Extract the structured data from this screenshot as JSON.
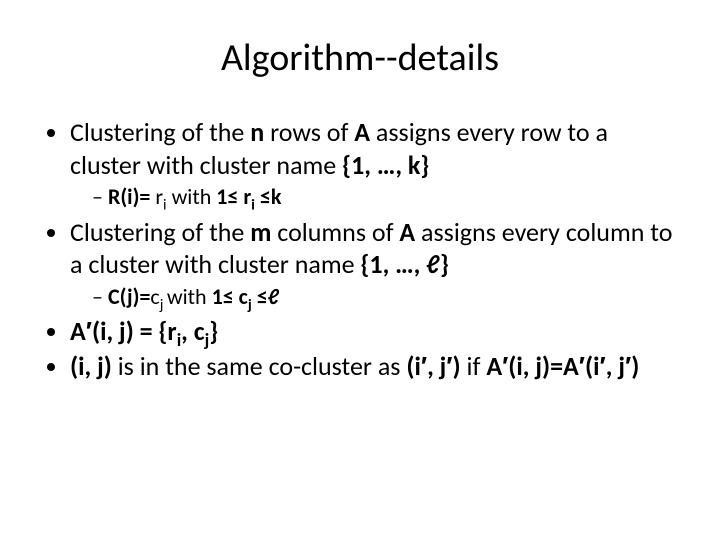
{
  "title": "Algorithm--details",
  "b1_pre": "Clustering of the ",
  "b1_n": "n",
  "b1_mid": " rows of ",
  "b1_A": "A",
  "b1_mid2": " assigns every row to a cluster with cluster name ",
  "b1_set": "{1, …, k}",
  "b1s_R": "R(i)= ",
  "b1s_r": "r",
  "b1s_ri": "i",
  "b1s_with": " with ",
  "b1s_cond1": "1≤ r",
  "b1s_cond_i": "i",
  "b1s_cond2": " ≤k",
  "b2_pre": "Clustering of the ",
  "b2_m": "m",
  "b2_mid": " columns of ",
  "b2_A": "A",
  "b2_mid2": " assigns every column to a cluster with cluster name ",
  "b2_set": "{1, …, ℓ}",
  "b2s_C": "C(j)=",
  "b2s_c": "c",
  "b2s_cj": "j ",
  "b2s_with": "with ",
  "b2s_cond1": "1≤ c",
  "b2s_cond_j": "j",
  "b2s_cond2": " ≤ℓ",
  "b3_A": "A′(i, j) = {r",
  "b3_i": "i",
  "b3_mid": ", c",
  "b3_j": "j",
  "b3_end": "}",
  "b4_ij": "(i, j)",
  "b4_txt": " is in the same co-cluster as ",
  "b4_ij2": "(i′, j′)",
  "b4_if": " if ",
  "b4_eq": "A′(i, j)=A′(i′, j′)"
}
